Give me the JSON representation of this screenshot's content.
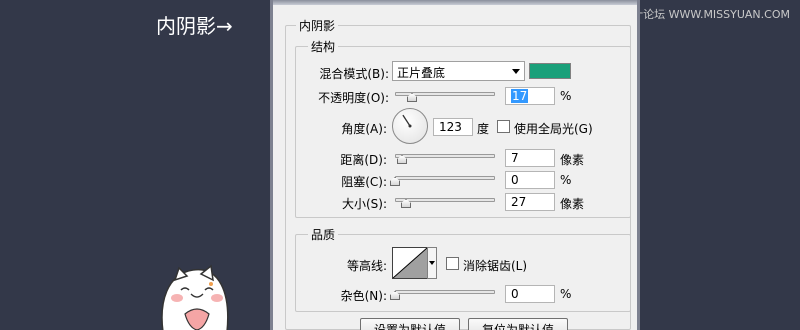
{
  "caption": "内阴影→",
  "watermark": "思缘设计论坛 WWW.MISSYUAN.COM",
  "dialog": {
    "section_title": "内阴影",
    "structure": {
      "title": "结构",
      "blend_mode": {
        "label": "混合模式(B):",
        "value": "正片叠底"
      },
      "color": "#1aa07a",
      "opacity": {
        "label": "不透明度(O):",
        "value": "17",
        "unit": "%",
        "fraction": 0.17
      },
      "angle": {
        "label": "角度(A):",
        "value": "123",
        "unit": "度",
        "degrees": 123
      },
      "global_light": {
        "label": "使用全局光(G)",
        "checked": false
      },
      "distance": {
        "label": "距离(D):",
        "value": "7",
        "unit": "像素",
        "fraction": 0.07
      },
      "choke": {
        "label": "阻塞(C):",
        "value": "0",
        "unit": "%",
        "fraction": 0.0
      },
      "size": {
        "label": "大小(S):",
        "value": "27",
        "unit": "像素",
        "fraction": 0.11
      }
    },
    "quality": {
      "title": "品质",
      "contour": {
        "label": "等高线:"
      },
      "anti_alias": {
        "label": "消除锯齿(L)",
        "checked": false
      },
      "noise": {
        "label": "杂色(N):",
        "value": "0",
        "unit": "%",
        "fraction": 0.0
      }
    },
    "buttons": {
      "make_default": "设置为默认值",
      "reset_default": "复位为默认值"
    }
  }
}
